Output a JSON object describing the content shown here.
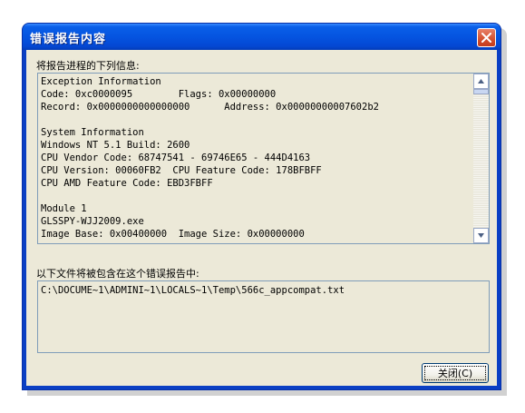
{
  "window": {
    "title": "错误报告内容"
  },
  "report": {
    "label": "将报告进程的下列信息:",
    "lines": [
      "Exception Information",
      "Code: 0xc0000095        Flags: 0x00000000",
      "Record: 0x0000000000000000      Address: 0x00000000007602b2",
      "",
      "System Information",
      "Windows NT 5.1 Build: 2600",
      "CPU Vendor Code: 68747541 - 69746E65 - 444D4163",
      "CPU Version: 00060FB2  CPU Feature Code: 178BFBFF",
      "CPU AMD Feature Code: EBD3FBFF",
      "",
      "Module 1",
      "GLSSPY-WJJ2009.exe",
      "Image Base: 0x00400000  Image Size: 0x00000000"
    ]
  },
  "files": {
    "label": "以下文件将被包含在这个错误报告中:",
    "path": "C:\\DOCUME~1\\ADMINI~1\\LOCALS~1\\Temp\\566c_appcompat.txt"
  },
  "buttons": {
    "close_label": "关闭(C)"
  },
  "icons": {
    "close": "close-icon",
    "scroll_up": "scroll-up-arrow-icon",
    "scroll_down": "scroll-down-arrow-icon"
  }
}
